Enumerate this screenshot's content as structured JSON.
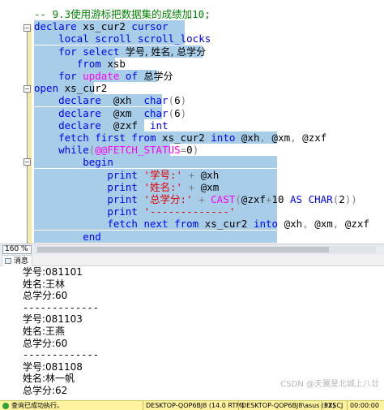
{
  "editor": {
    "lines": [
      {
        "indent": "",
        "parts": [
          {
            "cls": "c",
            "text": "-- 9.3使用游标把数据集的成绩加10;"
          }
        ],
        "sel": 0
      },
      {
        "indent": "",
        "parts": [
          {
            "cls": "k",
            "text": "declare"
          },
          {
            "cls": "id",
            "text": " xs_cur2 "
          },
          {
            "cls": "k",
            "text": "cursor"
          }
        ],
        "sel": 186
      },
      {
        "indent": "    ",
        "parts": [
          {
            "cls": "k",
            "text": "local scroll scroll_locks"
          }
        ],
        "sel": 186
      },
      {
        "indent": "    ",
        "parts": [
          {
            "cls": "k",
            "text": "for select "
          },
          {
            "cls": "cn",
            "text": "学号, 姓名, 总学分"
          }
        ],
        "sel": 208
      },
      {
        "indent": "       ",
        "parts": [
          {
            "cls": "k",
            "text": "from"
          },
          {
            "cls": "id",
            "text": " xsb"
          }
        ],
        "sel": 100
      },
      {
        "indent": "    ",
        "parts": [
          {
            "cls": "k",
            "text": "for "
          },
          {
            "cls": "f",
            "text": "update"
          },
          {
            "cls": "k",
            "text": " of "
          },
          {
            "cls": "cn",
            "text": "总学分"
          }
        ],
        "sel": 152
      },
      {
        "indent": "",
        "parts": [
          {
            "cls": "k",
            "text": "open"
          },
          {
            "cls": "id",
            "text": " xs_cur2"
          }
        ],
        "sel": 74
      },
      {
        "indent": "    ",
        "parts": [
          {
            "cls": "k",
            "text": "declare"
          },
          {
            "cls": "id",
            "text": "  @xh  "
          },
          {
            "cls": "k",
            "text": "char"
          },
          {
            "cls": "g",
            "text": "("
          },
          {
            "cls": "id",
            "text": "6"
          },
          {
            "cls": "g",
            "text": ")"
          }
        ],
        "sel": 158
      },
      {
        "indent": "    ",
        "parts": [
          {
            "cls": "k",
            "text": "declare"
          },
          {
            "cls": "id",
            "text": "  @xm  "
          },
          {
            "cls": "k",
            "text": "char"
          },
          {
            "cls": "g",
            "text": "("
          },
          {
            "cls": "id",
            "text": "6"
          },
          {
            "cls": "g",
            "text": ")"
          }
        ],
        "sel": 158
      },
      {
        "indent": "    ",
        "parts": [
          {
            "cls": "k",
            "text": "declare"
          },
          {
            "cls": "id",
            "text": "  @zxf  "
          },
          {
            "cls": "k",
            "text": "int"
          }
        ],
        "sel": 136
      },
      {
        "indent": "    ",
        "parts": [
          {
            "cls": "k",
            "text": "fetch first from"
          },
          {
            "cls": "id",
            "text": " xs_cur2 "
          },
          {
            "cls": "k",
            "text": "into"
          },
          {
            "cls": "id",
            "text": " @xh"
          },
          {
            "cls": "g",
            "text": ","
          },
          {
            "cls": "id",
            "text": " @xm"
          },
          {
            "cls": "g",
            "text": ","
          },
          {
            "cls": "id",
            "text": " @zxf"
          }
        ],
        "sel": 300
      },
      {
        "indent": "    ",
        "parts": [
          {
            "cls": "k",
            "text": "while"
          },
          {
            "cls": "g",
            "text": "("
          },
          {
            "cls": "f",
            "text": "@@FETCH_STATUS"
          },
          {
            "cls": "g",
            "text": "="
          },
          {
            "cls": "id",
            "text": "0"
          },
          {
            "cls": "g",
            "text": ")"
          }
        ],
        "sel": 168
      },
      {
        "indent": "        ",
        "parts": [
          {
            "cls": "k",
            "text": "begin"
          }
        ],
        "sel": 300
      },
      {
        "indent": "            ",
        "parts": [
          {
            "cls": "k",
            "text": "print"
          },
          {
            "cls": "id",
            "text": " "
          },
          {
            "cls": "s",
            "text": "'学号:'"
          },
          {
            "cls": "id",
            "text": " "
          },
          {
            "cls": "g",
            "text": "+"
          },
          {
            "cls": "id",
            "text": " @xh"
          }
        ],
        "sel": 300
      },
      {
        "indent": "            ",
        "parts": [
          {
            "cls": "k",
            "text": "print"
          },
          {
            "cls": "id",
            "text": " "
          },
          {
            "cls": "s",
            "text": "'姓名:'"
          },
          {
            "cls": "id",
            "text": " "
          },
          {
            "cls": "g",
            "text": "+"
          },
          {
            "cls": "id",
            "text": " @xm"
          }
        ],
        "sel": 300
      },
      {
        "indent": "            ",
        "parts": [
          {
            "cls": "k",
            "text": "print"
          },
          {
            "cls": "id",
            "text": " "
          },
          {
            "cls": "s",
            "text": "'总学分:'"
          },
          {
            "cls": "id",
            "text": " "
          },
          {
            "cls": "g",
            "text": "+"
          },
          {
            "cls": "id",
            "text": " "
          },
          {
            "cls": "f",
            "text": "CAST"
          },
          {
            "cls": "g",
            "text": "("
          },
          {
            "cls": "id",
            "text": "@zxf"
          },
          {
            "cls": "g",
            "text": "+"
          },
          {
            "cls": "id",
            "text": "10 "
          },
          {
            "cls": "k",
            "text": "AS CHAR"
          },
          {
            "cls": "g",
            "text": "("
          },
          {
            "cls": "id",
            "text": "2"
          },
          {
            "cls": "g",
            "text": "))"
          }
        ],
        "sel": 300
      },
      {
        "indent": "            ",
        "parts": [
          {
            "cls": "k",
            "text": "print"
          },
          {
            "cls": "id",
            "text": " "
          },
          {
            "cls": "s",
            "text": "'-------------'"
          }
        ],
        "sel": 300
      },
      {
        "indent": "            ",
        "parts": [
          {
            "cls": "k",
            "text": "fetch next from"
          },
          {
            "cls": "id",
            "text": " xs_cur2 "
          },
          {
            "cls": "k",
            "text": "into"
          },
          {
            "cls": "id",
            "text": " @xh"
          },
          {
            "cls": "g",
            "text": ","
          },
          {
            "cls": "id",
            "text": " @xm"
          },
          {
            "cls": "g",
            "text": ","
          },
          {
            "cls": "id",
            "text": " @zxf"
          }
        ],
        "sel": 300
      },
      {
        "indent": "        ",
        "parts": [
          {
            "cls": "k",
            "text": "end"
          }
        ],
        "sel": 300
      }
    ]
  },
  "zoom": {
    "label": "160 %"
  },
  "results": {
    "tab_label": "消息",
    "lines": [
      "学号:081101",
      "姓名:王林",
      "总学分:60",
      "-------------",
      "学号:081103",
      "姓名:王燕",
      "总学分:60",
      "-------------",
      "学号:081108",
      "姓名:林一帆",
      "总学分:62"
    ]
  },
  "zoom_bottom": {
    "label": "160 %"
  },
  "status": {
    "message": "查询已成功执行。",
    "server": "DESKTOP-QOP6BJ8 (14.0 RTM)",
    "connection": "DESKTOP-QOP6BJ8\\asus (52)",
    "database": "PXSCJ",
    "time": "00:00:00",
    "accent": "#fff3a0"
  },
  "watermark": {
    "text": "CSDN @天翼星北城上八廿"
  }
}
